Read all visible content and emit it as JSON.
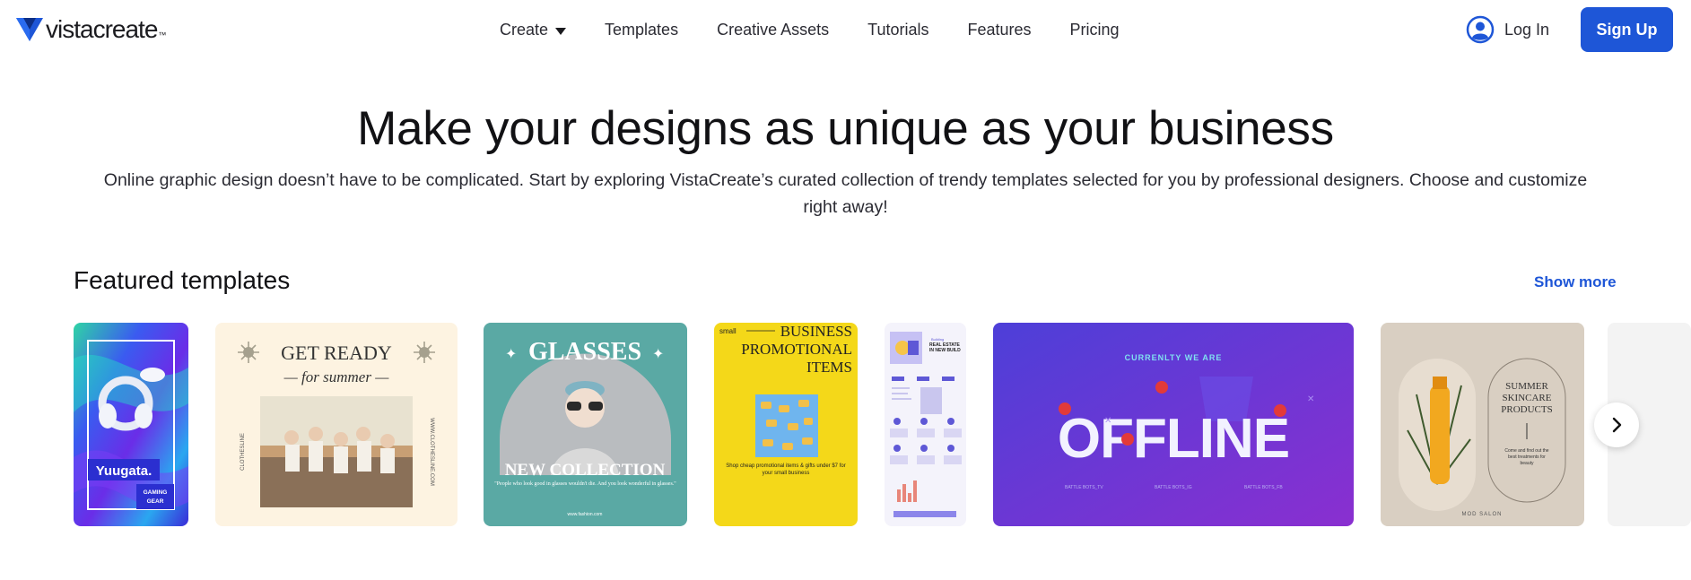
{
  "header": {
    "logo": {
      "brand_light": "vista",
      "brand_bold": "create",
      "tm": "™"
    },
    "nav": [
      {
        "label": "Create",
        "has_dropdown": true
      },
      {
        "label": "Templates"
      },
      {
        "label": "Creative Assets"
      },
      {
        "label": "Tutorials"
      },
      {
        "label": "Features"
      },
      {
        "label": "Pricing"
      }
    ],
    "login_label": "Log In",
    "signup_label": "Sign Up"
  },
  "hero": {
    "title": "Make your designs as unique as your business",
    "subtitle": "Online graphic design doesn’t have to be complicated. Start by exploring VistaCreate’s curated collection of trendy templates selected for you by professional designers. Choose and customize right away!"
  },
  "featured": {
    "title": "Featured templates",
    "show_more_label": "Show more",
    "cards": [
      {
        "name": "Yuugata gaming gear",
        "texts": [
          "Yuugata.",
          "GAMING",
          "GEAR"
        ]
      },
      {
        "name": "Get ready for summer",
        "texts": [
          "GET READY",
          "— for summer —",
          "CLOTHESLINE",
          "WWW.CLOTHESLINE.COM"
        ]
      },
      {
        "name": "Glasses new collection",
        "texts": [
          "GLASSES",
          "NEW COLLECTION",
          "\"People who look good in glasses wouldn't die. And you look wonderful in glasses.\"",
          "www.fashion.com"
        ]
      },
      {
        "name": "Business promotional items",
        "texts": [
          "small",
          "BUSINESS",
          "PROMOTIONAL",
          "ITEMS",
          "Shop cheap promotional items & gifts under $7 for your small business"
        ]
      },
      {
        "name": "Real estate new build",
        "texts": [
          "REAL ESTATE IN NEW BUILD",
          "Building"
        ]
      },
      {
        "name": "Currently we are offline",
        "texts": [
          "CURRENLTY WE ARE",
          "OFFLINE",
          "BATTLE BOTS_TV",
          "BATTLE BOTS_IG",
          "BATTLE BOTS_FB"
        ]
      },
      {
        "name": "Summer skincare products",
        "texts": [
          "SUMMER",
          "SKINCARE",
          "PRODUCTS",
          "Come and find out the best treatments for beauty",
          "MOD SALON"
        ]
      }
    ]
  },
  "colors": {
    "accent": "#1e56d7",
    "text": "#111114"
  }
}
